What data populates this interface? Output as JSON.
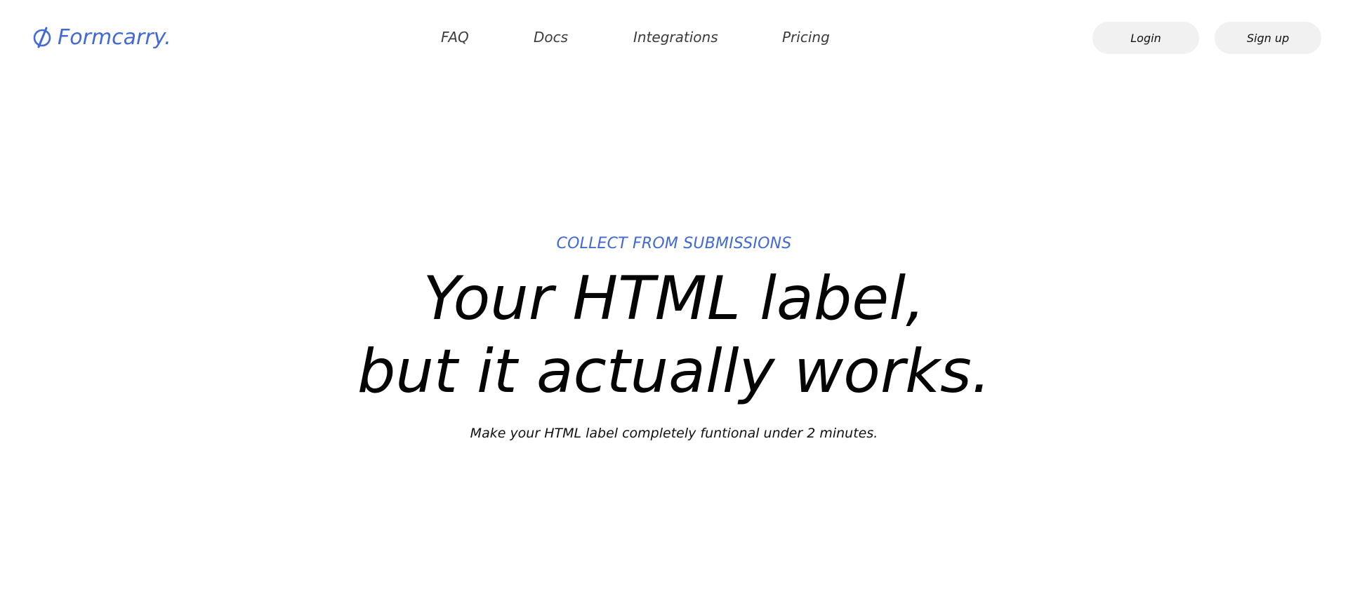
{
  "brand": {
    "name": "Formcarry.",
    "icon": "formcarry-logo-icon",
    "color": "#4169d8"
  },
  "nav": {
    "items": [
      {
        "label": "FAQ"
      },
      {
        "label": "Docs"
      },
      {
        "label": "Integrations"
      },
      {
        "label": "Pricing"
      }
    ]
  },
  "auth": {
    "login_label": "Login",
    "signup_label": "Sign up"
  },
  "hero": {
    "eyebrow": "COLLECT FROM SUBMISSIONS",
    "headline_line1": "Your HTML label,",
    "headline_line2": "but it actually works.",
    "subtitle": "Make your HTML label completely funtional under 2 minutes."
  },
  "colors": {
    "accent": "#4169d8",
    "button_bg": "#f1f1f1",
    "text": "#050505",
    "nav_text": "#3b3b3b"
  }
}
